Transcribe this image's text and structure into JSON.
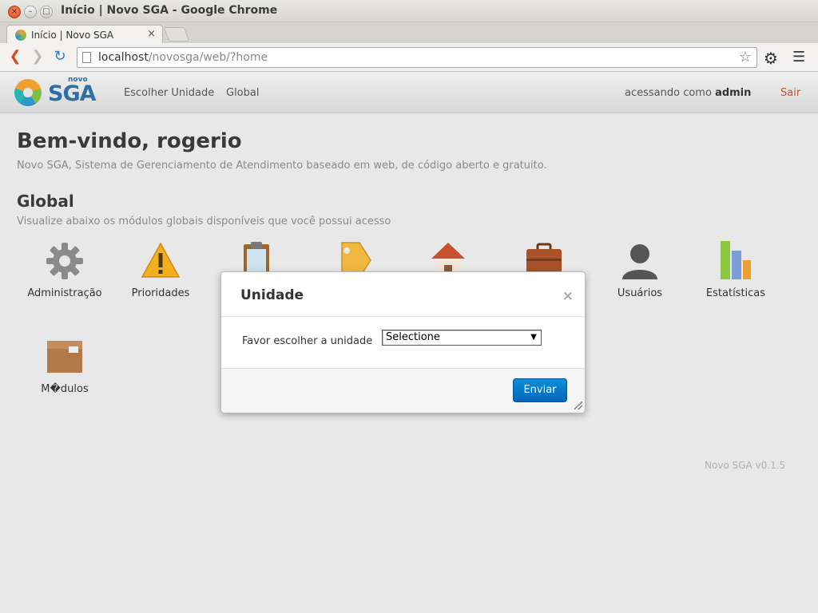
{
  "window": {
    "title": "Início | Novo SGA - Google Chrome",
    "tab_title": "Início | Novo SGA",
    "tab_close": "×"
  },
  "browser": {
    "url_host": "localhost",
    "url_path": "/novosga/web/?home",
    "star_icon": "star-icon",
    "settings_icon": "gear-icon",
    "menu_icon": "menu-icon"
  },
  "navbar": {
    "logo_small": "novo",
    "logo_main": "SGA",
    "links": [
      "Escolher Unidade",
      "Global"
    ],
    "user_prefix": "acessando como",
    "user_name": "admin",
    "logout": "Sair"
  },
  "main": {
    "welcome": "Bem-vindo, rogerio",
    "subtitle": "Novo SGA, Sistema de Gerenciamento de Atendimento baseado em web, de código aberto e gratuito.",
    "section_title": "Global",
    "section_subtitle": "Visualize abaixo os módulos globais disponíveis que você possui acesso",
    "modules": [
      {
        "label": "Administração",
        "icon": "gear-icon"
      },
      {
        "label": "Prioridades",
        "icon": "warning-icon"
      },
      {
        "label": "",
        "icon": "clipboard-icon"
      },
      {
        "label": "",
        "icon": "tag-icon"
      },
      {
        "label": "",
        "icon": "house-icon"
      },
      {
        "label": "",
        "icon": "briefcase-icon"
      },
      {
        "label": "Usuários",
        "icon": "user-icon"
      },
      {
        "label": "Estatísticas",
        "icon": "bar-chart-icon"
      },
      {
        "label": "M�dulos",
        "icon": "package-icon"
      }
    ],
    "version": "Novo SGA v0.1.5"
  },
  "modal": {
    "title": "Unidade",
    "close": "×",
    "field_label": "Favor escolher a unidade",
    "select_value": "Selectione",
    "submit": "Enviar"
  },
  "colors": {
    "brand": "#2f6fa8",
    "primary_button": "#0a7cc9",
    "logout": "#d04a2a"
  }
}
